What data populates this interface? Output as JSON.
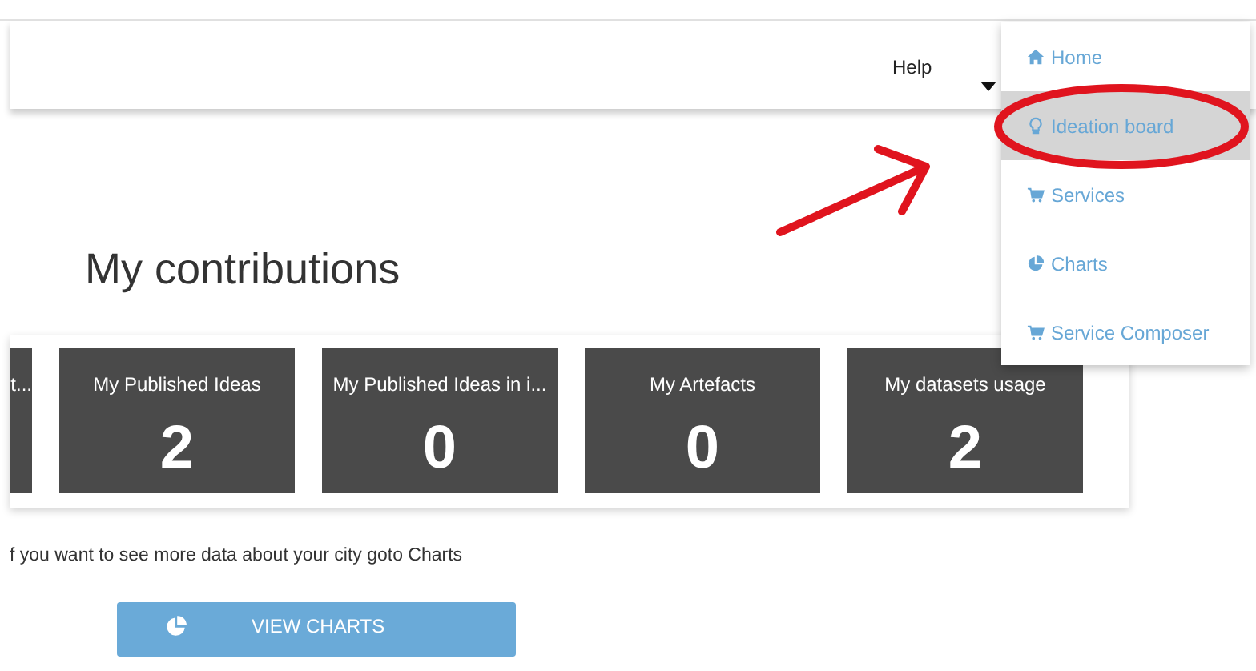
{
  "navbar": {
    "help": {
      "label": "Help"
    }
  },
  "dropdown": {
    "items": [
      {
        "label": "Home",
        "kind": "home",
        "selected": false
      },
      {
        "label": "Ideation board",
        "kind": "bulb",
        "selected": true
      },
      {
        "label": "Services",
        "kind": "cart",
        "selected": false
      },
      {
        "label": "Charts",
        "kind": "pie",
        "selected": false
      },
      {
        "label": "Service Composer",
        "kind": "cart",
        "selected": false
      }
    ]
  },
  "heading": "My contributions",
  "stats": [
    {
      "kind": "clipped",
      "title": "t..."
    },
    {
      "kind": "full",
      "title": "My Published Ideas",
      "value": "2"
    },
    {
      "kind": "full",
      "title": "My Published Ideas in i...",
      "value": "0"
    },
    {
      "kind": "full",
      "title": "My Artefacts",
      "value": "0"
    },
    {
      "kind": "full",
      "title": "My datasets usage",
      "value": "2"
    }
  ],
  "info_text": "f you want to see more data about your city goto Charts",
  "charts_button": {
    "label": "VIEW CHARTS"
  },
  "annotation": {
    "ellipse": true,
    "arrow": true
  }
}
